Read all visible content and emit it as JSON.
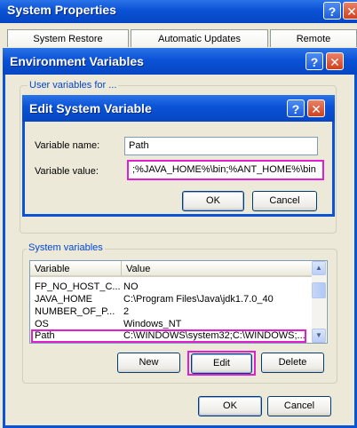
{
  "system_properties": {
    "title": "System Properties",
    "help_button": "?",
    "close_button": "✕",
    "tabs": [
      "System Restore",
      "Automatic Updates",
      "Remote"
    ]
  },
  "environment_variables": {
    "title": "Environment Variables",
    "help_button": "?",
    "close_button": "✕",
    "user_variables_label": "User variables for ...",
    "system_variables_label": "System variables",
    "columns": {
      "variable": "Variable",
      "value": "Value"
    },
    "rows": [
      {
        "variable": "FP_NO_HOST_C...",
        "value": "NO"
      },
      {
        "variable": "JAVA_HOME",
        "value": "C:\\Program Files\\Java\\jdk1.7.0_40"
      },
      {
        "variable": "NUMBER_OF_P...",
        "value": "2"
      },
      {
        "variable": "OS",
        "value": "Windows_NT"
      },
      {
        "variable": "Path",
        "value": "C:\\WINDOWS\\system32;C:\\WINDOWS;..."
      }
    ],
    "buttons": {
      "new": "New",
      "edit": "Edit",
      "delete": "Delete",
      "ok": "OK",
      "cancel": "Cancel"
    }
  },
  "edit_system_variable": {
    "title": "Edit System Variable",
    "help_button": "?",
    "close_button": "✕",
    "name_label": "Variable name:",
    "name_value": "Path",
    "value_label": "Variable value:",
    "value_value": ";%JAVA_HOME%\\bin;%ANT_HOME%\\bin",
    "buttons": {
      "ok": "OK",
      "cancel": "Cancel"
    }
  },
  "colors": {
    "title_blue": "#0a52d6",
    "highlight": "#e020d0",
    "group_label": "#0046d5"
  }
}
